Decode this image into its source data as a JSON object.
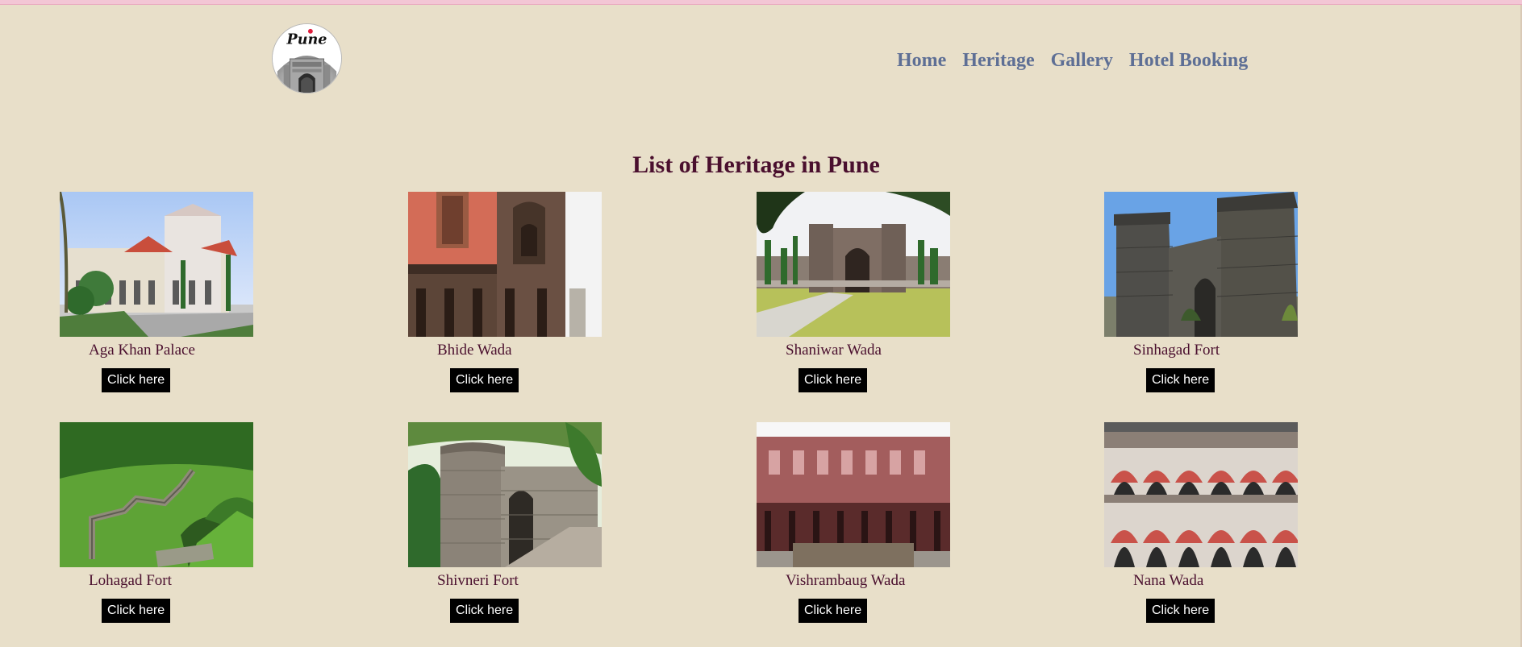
{
  "logo": {
    "text": "Pune",
    "icon": "pune-gate-logo"
  },
  "nav": {
    "items": [
      {
        "label": "Home"
      },
      {
        "label": "Heritage"
      },
      {
        "label": "Gallery"
      },
      {
        "label": "Hotel Booking"
      }
    ]
  },
  "page": {
    "title": "List of Heritage in Pune"
  },
  "cards": [
    {
      "name": "Aga Khan Palace",
      "button": "Click here"
    },
    {
      "name": "Bhide Wada",
      "button": "Click here"
    },
    {
      "name": "Shaniwar Wada",
      "button": "Click here"
    },
    {
      "name": "Sinhagad Fort",
      "button": "Click here"
    },
    {
      "name": "Lohagad Fort",
      "button": "Click here"
    },
    {
      "name": "Shivneri Fort",
      "button": "Click here"
    },
    {
      "name": "Vishrambaug Wada",
      "button": "Click here"
    },
    {
      "name": "Nana Wada",
      "button": "Click here"
    }
  ],
  "theme": {
    "background": "#e8dfc9",
    "nav_color": "#5e6f95",
    "title_color": "#4a0f2e",
    "button_bg": "#000000",
    "button_text": "#ffffff"
  }
}
